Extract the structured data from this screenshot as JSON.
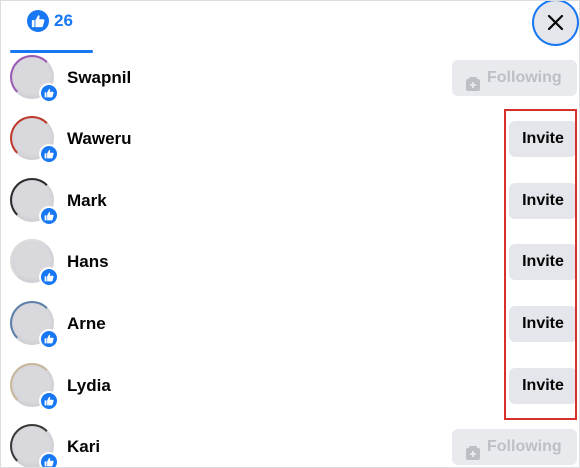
{
  "header": {
    "reaction_icon": "like-icon",
    "count": "26",
    "close_icon": "close-icon"
  },
  "people": [
    {
      "name": "Swapnil",
      "action": "Following",
      "ring": "#9b59b6"
    },
    {
      "name": "Waweru",
      "action": "Invite",
      "ring": "#c0392b"
    },
    {
      "name": "Mark",
      "action": "Invite",
      "ring": "#2b2b2b"
    },
    {
      "name": "Hans",
      "action": "Invite",
      "ring": "#dcdcdc"
    },
    {
      "name": "Arne",
      "action": "Invite",
      "ring": "#5b7fa8"
    },
    {
      "name": "Lydia",
      "action": "Invite",
      "ring": "#c8b79a"
    },
    {
      "name": "Kari",
      "action": "Following",
      "ring": "#3a3a3a"
    }
  ],
  "colors": {
    "accent": "#1877f2",
    "button_bg": "#e4e6eb",
    "highlight": "#d9302c"
  }
}
